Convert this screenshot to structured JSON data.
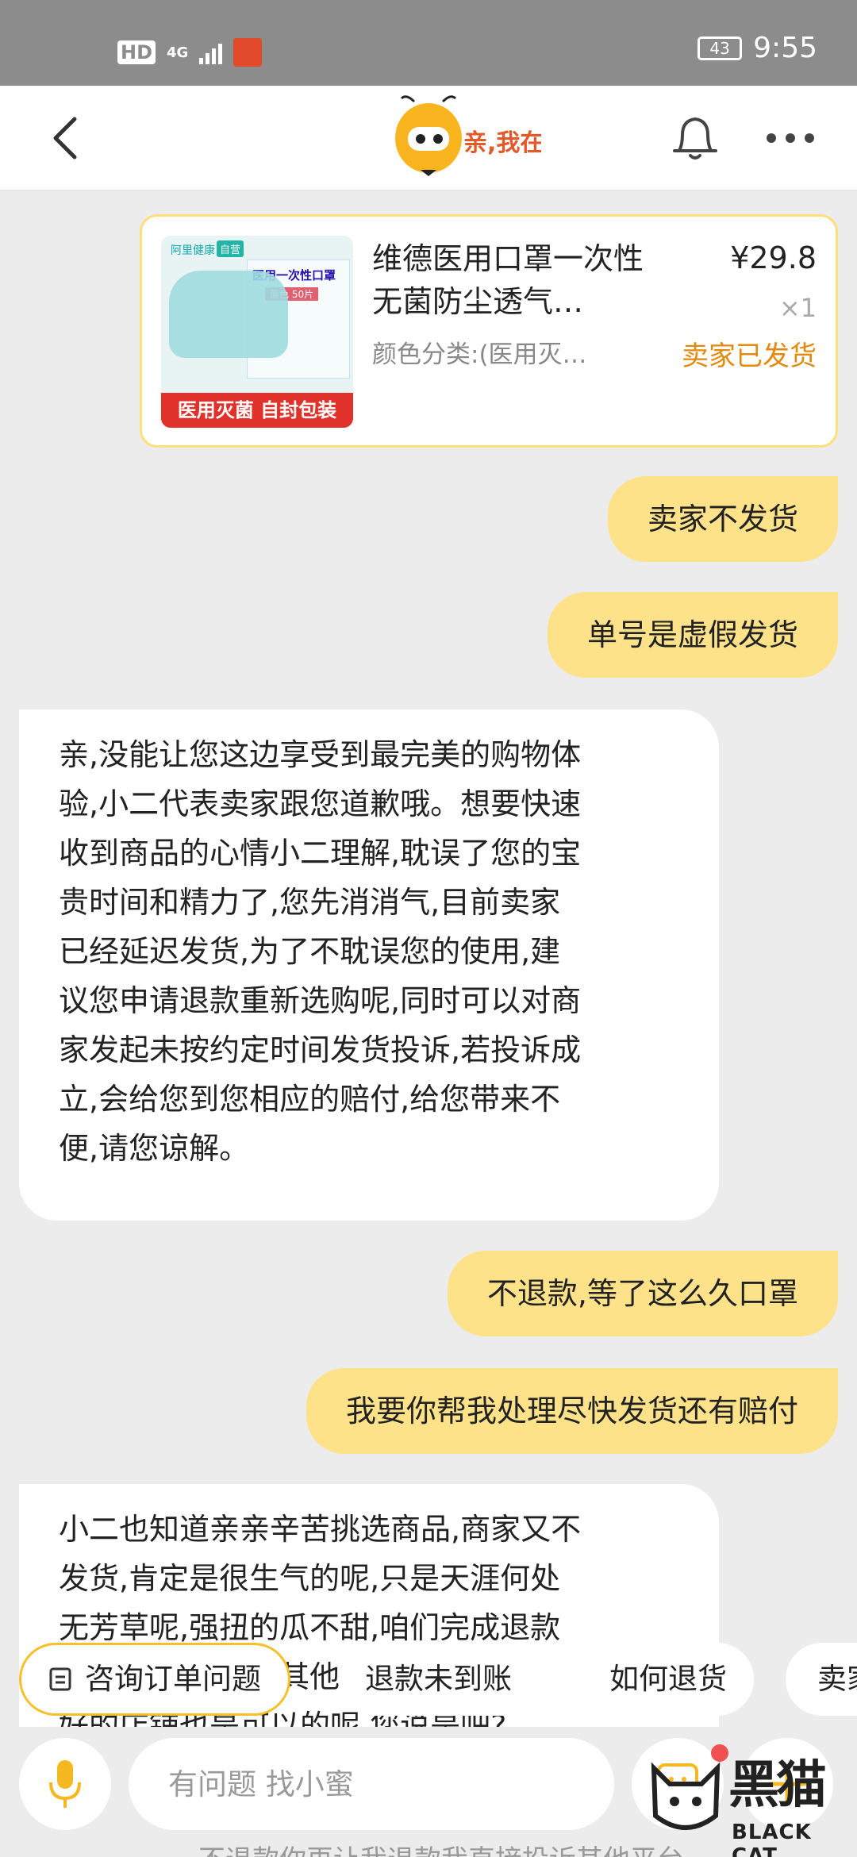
{
  "status_bar": {
    "hd": "HD",
    "network": "4G",
    "battery": "43",
    "time": "9:55"
  },
  "header": {
    "logo_text": "亲,我在"
  },
  "product": {
    "thumb_brand": "阿里健康",
    "thumb_tag": "自营",
    "thumb_box_title": "医用一次性口罩",
    "thumb_box_sub": "蓝色 50片",
    "thumb_footer": "医用灭菌 自封包装",
    "title": "维德医用口罩一次性无菌防尘透气…",
    "spec": "颜色分类:(医用灭…",
    "price": "¥29.8",
    "qty": "×1",
    "status": "卖家已发货"
  },
  "messages": [
    {
      "side": "out",
      "text": "卖家不发货"
    },
    {
      "side": "out",
      "text": "单号是虚假发货"
    },
    {
      "side": "in",
      "lines": [
        "亲,没能让您这边享受到最完美的购物体",
        "验,小二代表卖家跟您道歉哦。想要快速",
        "收到商品的心情小二理解,耽误了您的宝",
        "贵时间和精力了,您先消消气,目前卖家",
        "已经延迟发货,为了不耽误您的使用,建",
        "议您申请退款重新选购呢,同时可以对商",
        "家发起未按约定时间发货投诉,若投诉成",
        "立,会给您到您相应的赔付,给您带来不",
        "便,请您谅解。"
      ]
    },
    {
      "side": "out",
      "text": "不退款,等了这么久口罩"
    },
    {
      "side": "out",
      "text": "我要你帮我处理尽快发货还有赔付"
    },
    {
      "side": "in",
      "lines": [
        "小二也知道亲亲辛苦挑选商品,商家又不",
        "发货,肯定是很生气的呢,只是天涯何处",
        "无芳草呢,强扭的瓜不甜,咱们完成退款",
        "后,再看看有没有其他更好的店铺,更",
        "好的店铺也是可以的呢,您说是吧?"
      ]
    }
  ],
  "quick_replies": [
    "咨询订单问题",
    "退款未到账",
    "如何退货",
    "卖家"
  ],
  "input": {
    "placeholder": "有问题 找小蜜"
  },
  "watermark": {
    "text": "黑猫",
    "sub": "BLACK CAT"
  },
  "peek_text": "不退款你再让我退款我直接投诉其他平台"
}
